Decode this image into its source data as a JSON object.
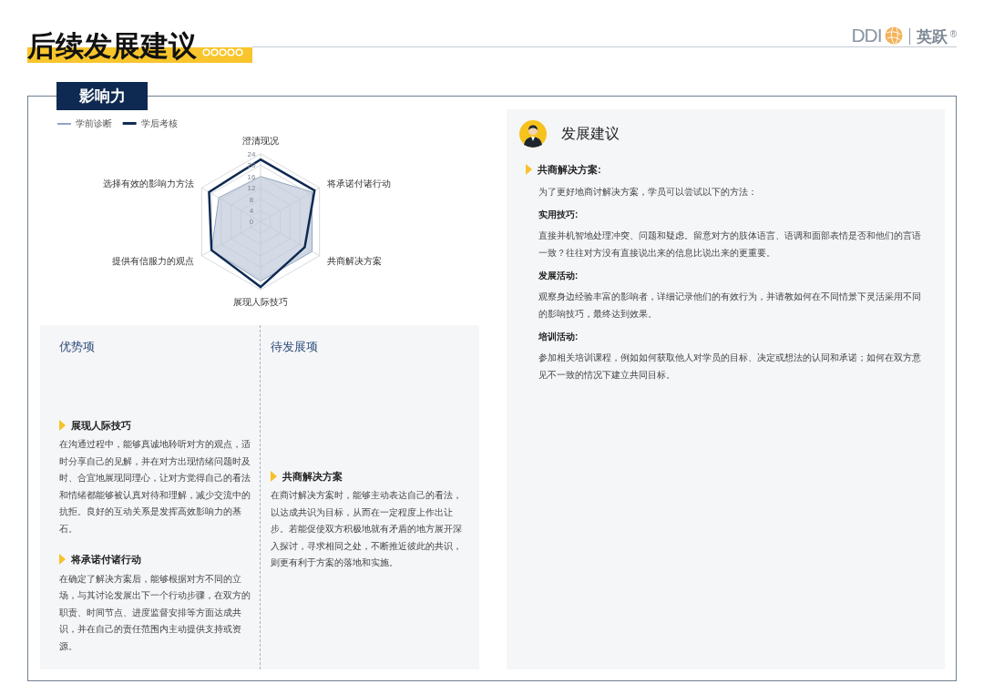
{
  "header": {
    "title": "后续发展建议",
    "logo": {
      "brand": "DDI",
      "name": "英跃",
      "mark": "®"
    }
  },
  "section": {
    "tab": "影响力",
    "radar": {
      "legend": [
        {
          "name": "学前诊断",
          "color": "#8fa3bf"
        },
        {
          "name": "学后考核",
          "color": "#0f2a52"
        }
      ],
      "axis_labels": [
        "澄清现况",
        "选择有效的影响力方法",
        "将承诺付诸行动",
        "提供有信服力的观点",
        "共商解决方案",
        "展现人际技巧"
      ],
      "tick_labels": [
        "24",
        "20",
        "16",
        "12",
        "8",
        "4",
        "0"
      ]
    },
    "strengths": {
      "title": "优势项",
      "items": [
        {
          "heading": "展现人际技巧",
          "text": "在沟通过程中，能够真诚地聆听对方的观点，适时分享自己的见解，并在对方出现情绪问题时及时、合宜地展现同理心，让对方觉得自己的看法和情绪都能够被认真对待和理解，减少交流中的抗拒。良好的互动关系是发挥高效影响力的基石。"
        },
        {
          "heading": "将承诺付诸行动",
          "text": "在确定了解决方案后，能够根据对方不同的立场，与其讨论发展出下一个行动步骤，在双方的职责、时间节点、进度监督安排等方面达成共识，并在自己的责任范围内主动提供支持或资源。"
        }
      ]
    },
    "development": {
      "title": "待发展项",
      "items": [
        {
          "heading": "共商解决方案",
          "text": "在商讨解决方案时，能够主动表达自己的看法，以达成共识为目标，从而在一定程度上作出让步。若能促使双方积极地就有矛盾的地方展开深入探讨，寻求相同之处，不断推近彼此的共识，则更有利于方案的落地和实施。"
        }
      ]
    }
  },
  "advice": {
    "title": "发展建议",
    "heading": "共商解决方案:",
    "intro": "为了更好地商讨解决方案，学员可以尝试以下的方法：",
    "blocks": [
      {
        "heading": "实用技巧:",
        "text": "直接并机智地处理冲突、问题和疑虑。留意对方的肢体语言、语调和面部表情是否和他们的言语一致？往往对方没有直接说出来的信息比说出来的更重要。"
      },
      {
        "heading": "发展活动:",
        "text": "观察身边经验丰富的影响者，详细记录他们的有效行为，并请教如何在不同情景下灵活采用不同的影响技巧，最终达到效果。"
      },
      {
        "heading": "培训活动:",
        "text": "参加相关培训课程，例如如何获取他人对学员的目标、决定或想法的认同和承诺；如何在双方意见不一致的情况下建立共同目标。"
      }
    ]
  }
}
